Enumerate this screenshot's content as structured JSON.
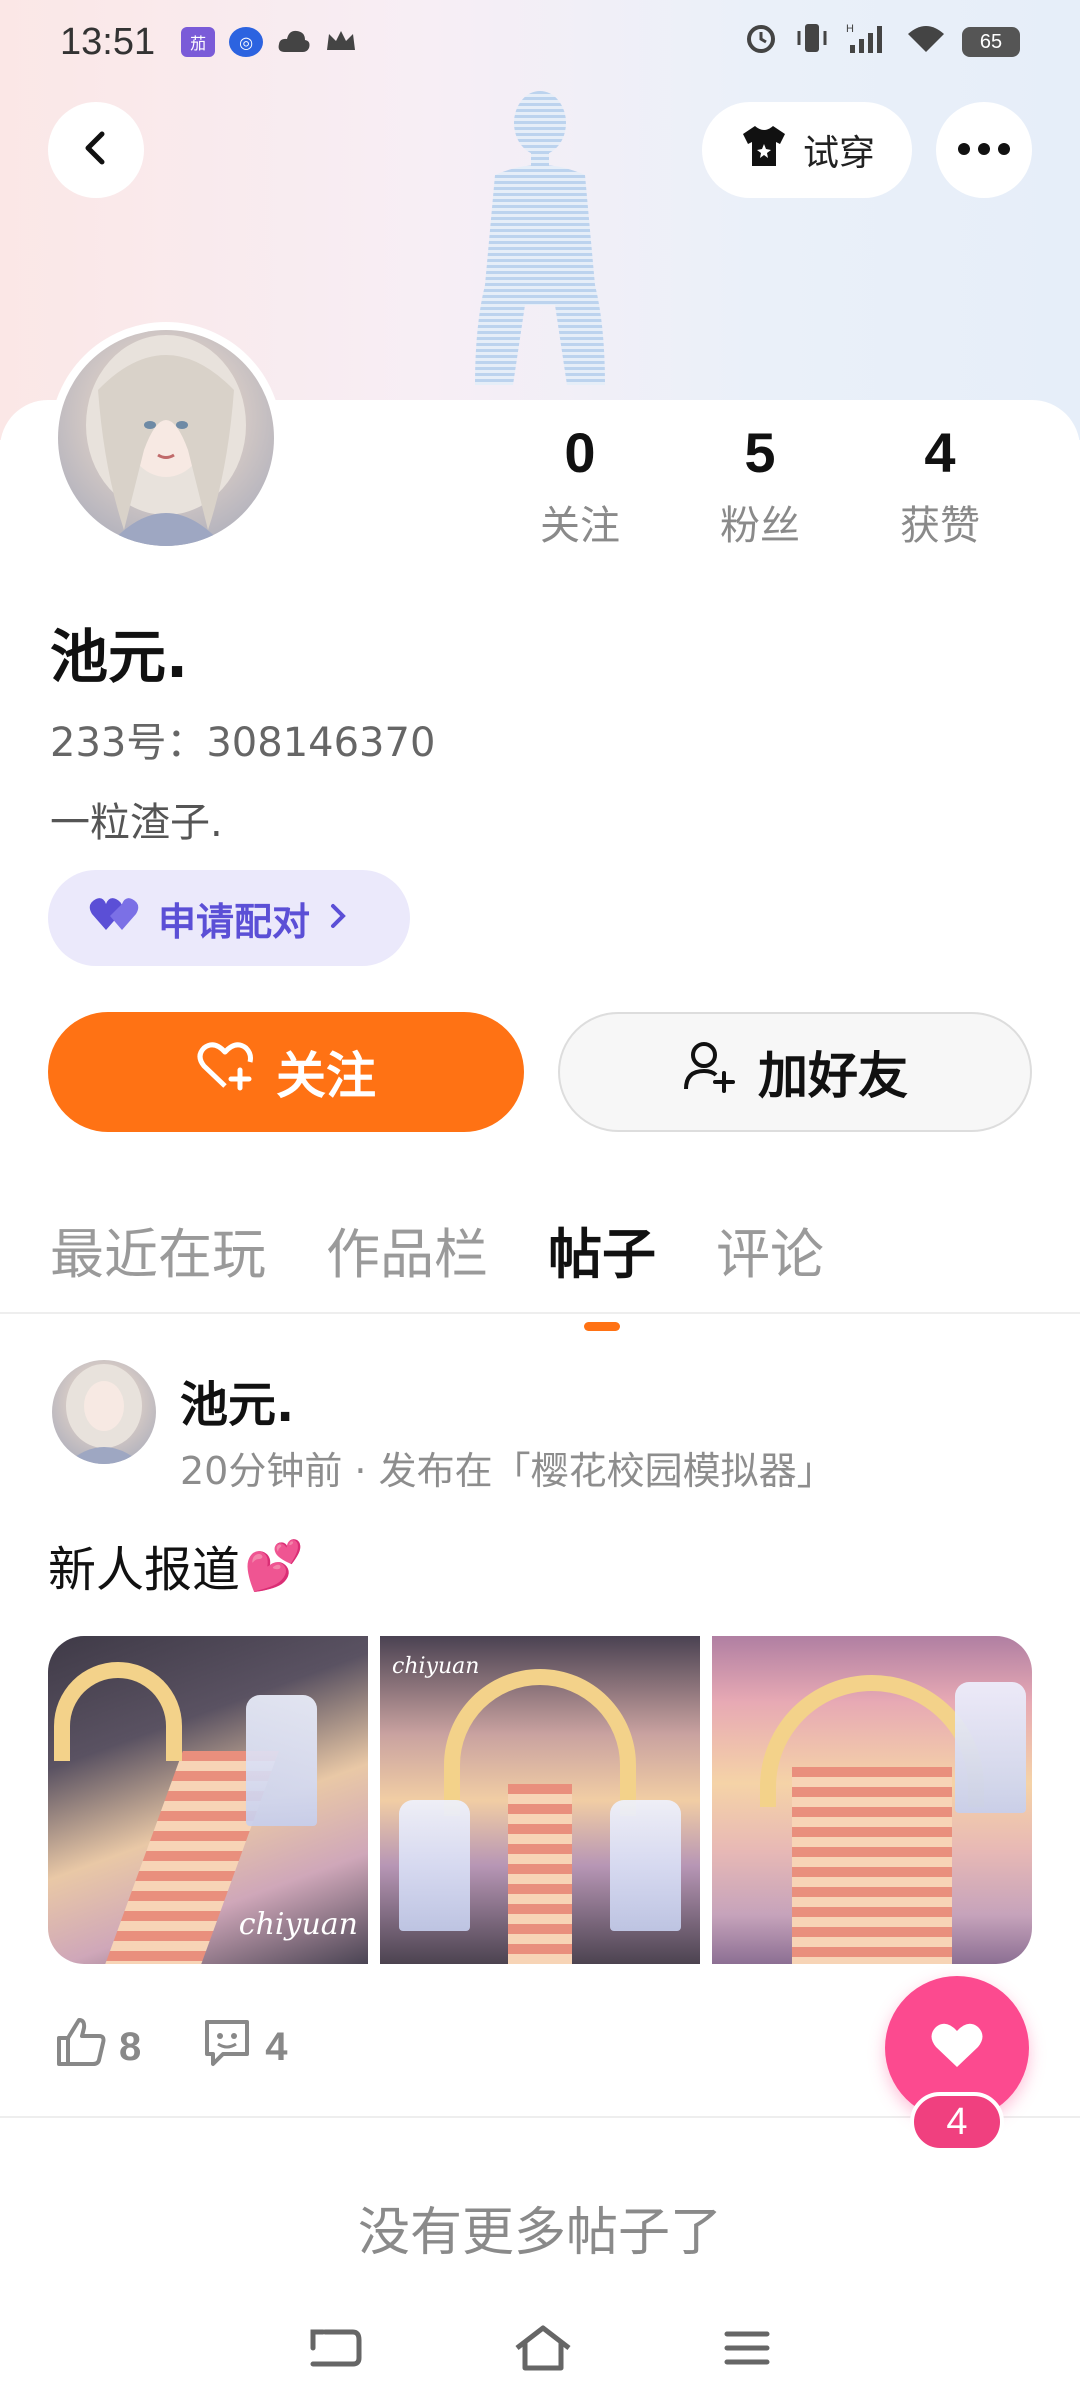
{
  "status_bar": {
    "time": "13:51",
    "battery": "65",
    "app_icons": [
      "qiezi-app-icon",
      "baidu-icon",
      "cloud-icon",
      "crown-icon"
    ]
  },
  "header": {
    "tryon_label": "试穿"
  },
  "profile": {
    "username": "池元.",
    "uid": "233号：308146370",
    "bio": "一粒渣子.",
    "match_label": "申请配对"
  },
  "stats": [
    {
      "value": "0",
      "label": "关注"
    },
    {
      "value": "5",
      "label": "粉丝"
    },
    {
      "value": "4",
      "label": "获赞"
    }
  ],
  "actions": {
    "follow_label": "关注",
    "add_friend_label": "加好友"
  },
  "tabs": [
    {
      "label": "最近在玩",
      "active": false
    },
    {
      "label": "作品栏",
      "active": false
    },
    {
      "label": "帖子",
      "active": true
    },
    {
      "label": "评论",
      "active": false
    }
  ],
  "post": {
    "author": "池元.",
    "meta": "20分钟前 · 发布在「樱花校园模拟器」",
    "title": "新人报道",
    "title_emoji": "💕",
    "likes": "8",
    "comments": "4",
    "images": [
      "chiyuan",
      "chiyuan",
      ""
    ]
  },
  "fab": {
    "badge": "4"
  },
  "footer": {
    "no_more": "没有更多帖子了"
  },
  "colors": {
    "accent": "#ff7214",
    "match": "#5b4fd6",
    "fab": "#fc4a8f"
  }
}
